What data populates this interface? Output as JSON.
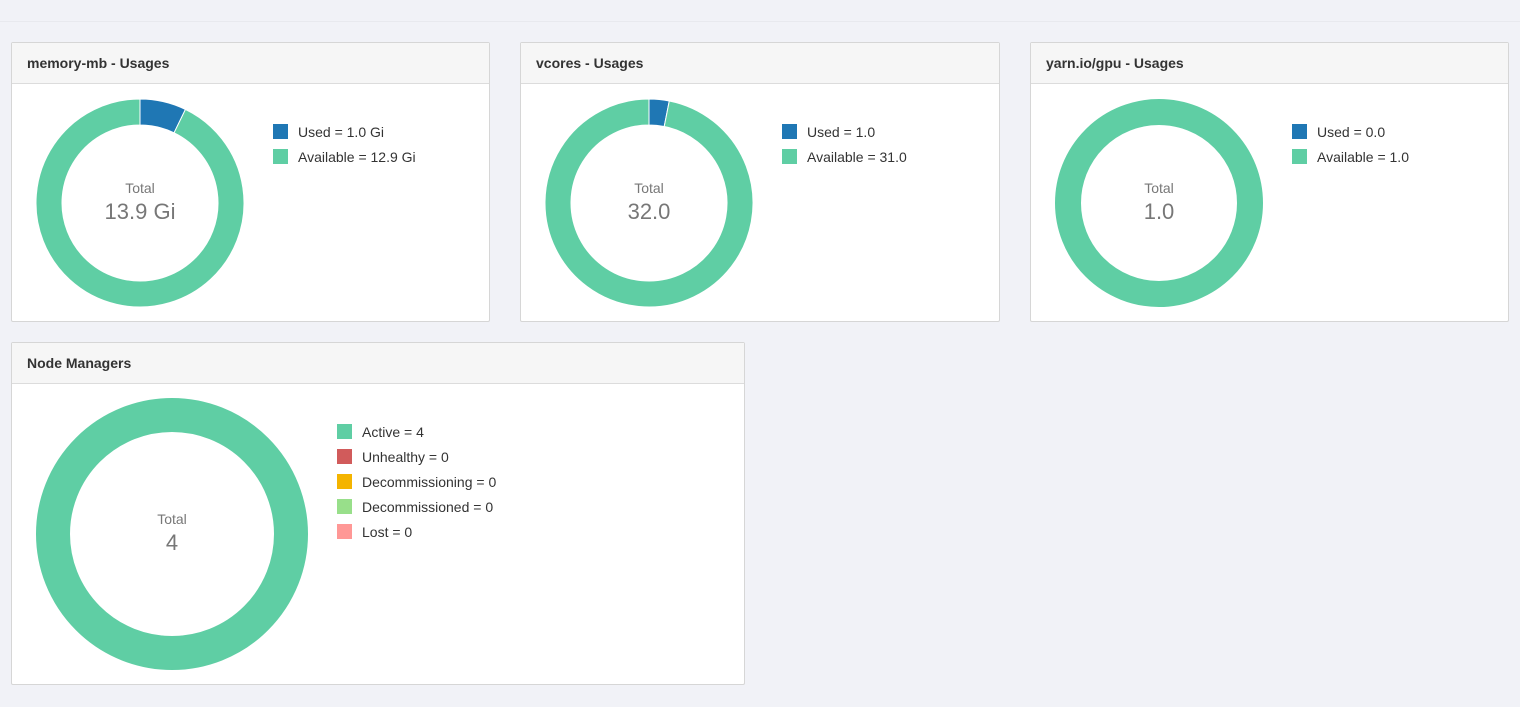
{
  "colors": {
    "used": "#1f77b4",
    "available": "#5fcea4",
    "active": "#5fcea4",
    "unhealthy": "#d15b5b",
    "decommissioning": "#f4b400",
    "decommissioned": "#98df8a",
    "lost": "#ff9896"
  },
  "panels": {
    "memory": {
      "title": "memory-mb - Usages",
      "total_label": "Total",
      "total_value": "13.9 Gi",
      "legend": [
        {
          "label": "Used = 1.0 Gi",
          "color": "#1f77b4"
        },
        {
          "label": "Available = 12.9 Gi",
          "color": "#5fcea4"
        }
      ],
      "slices": [
        {
          "name": "Used",
          "value": 1.0,
          "color": "#1f77b4"
        },
        {
          "name": "Available",
          "value": 12.9,
          "color": "#5fcea4"
        }
      ]
    },
    "vcores": {
      "title": "vcores - Usages",
      "total_label": "Total",
      "total_value": "32.0",
      "legend": [
        {
          "label": "Used = 1.0",
          "color": "#1f77b4"
        },
        {
          "label": "Available = 31.0",
          "color": "#5fcea4"
        }
      ],
      "slices": [
        {
          "name": "Used",
          "value": 1.0,
          "color": "#1f77b4"
        },
        {
          "name": "Available",
          "value": 31.0,
          "color": "#5fcea4"
        }
      ]
    },
    "gpu": {
      "title": "yarn.io/gpu - Usages",
      "total_label": "Total",
      "total_value": "1.0",
      "legend": [
        {
          "label": "Used = 0.0",
          "color": "#1f77b4"
        },
        {
          "label": "Available = 1.0",
          "color": "#5fcea4"
        }
      ],
      "slices": [
        {
          "name": "Used",
          "value": 0.0,
          "color": "#1f77b4"
        },
        {
          "name": "Available",
          "value": 1.0,
          "color": "#5fcea4"
        }
      ]
    },
    "nodes": {
      "title": "Node Managers",
      "total_label": "Total",
      "total_value": "4",
      "legend": [
        {
          "label": "Active = 4",
          "color": "#5fcea4"
        },
        {
          "label": "Unhealthy = 0",
          "color": "#d15b5b"
        },
        {
          "label": "Decommissioning = 0",
          "color": "#f4b400"
        },
        {
          "label": "Decommissioned = 0",
          "color": "#98df8a"
        },
        {
          "label": "Lost = 0",
          "color": "#ff9896"
        }
      ],
      "slices": [
        {
          "name": "Active",
          "value": 4,
          "color": "#5fcea4"
        },
        {
          "name": "Unhealthy",
          "value": 0,
          "color": "#d15b5b"
        },
        {
          "name": "Decommissioning",
          "value": 0,
          "color": "#f4b400"
        },
        {
          "name": "Decommissioned",
          "value": 0,
          "color": "#98df8a"
        },
        {
          "name": "Lost",
          "value": 0,
          "color": "#ff9896"
        }
      ]
    }
  },
  "chart_data": [
    {
      "type": "pie",
      "title": "memory-mb - Usages",
      "categories": [
        "Used",
        "Available"
      ],
      "values": [
        1.0,
        12.9
      ],
      "total": 13.9,
      "unit": "Gi"
    },
    {
      "type": "pie",
      "title": "vcores - Usages",
      "categories": [
        "Used",
        "Available"
      ],
      "values": [
        1.0,
        31.0
      ],
      "total": 32.0
    },
    {
      "type": "pie",
      "title": "yarn.io/gpu - Usages",
      "categories": [
        "Used",
        "Available"
      ],
      "values": [
        0.0,
        1.0
      ],
      "total": 1.0
    },
    {
      "type": "pie",
      "title": "Node Managers",
      "categories": [
        "Active",
        "Unhealthy",
        "Decommissioning",
        "Decommissioned",
        "Lost"
      ],
      "values": [
        4,
        0,
        0,
        0,
        0
      ],
      "total": 4
    }
  ]
}
